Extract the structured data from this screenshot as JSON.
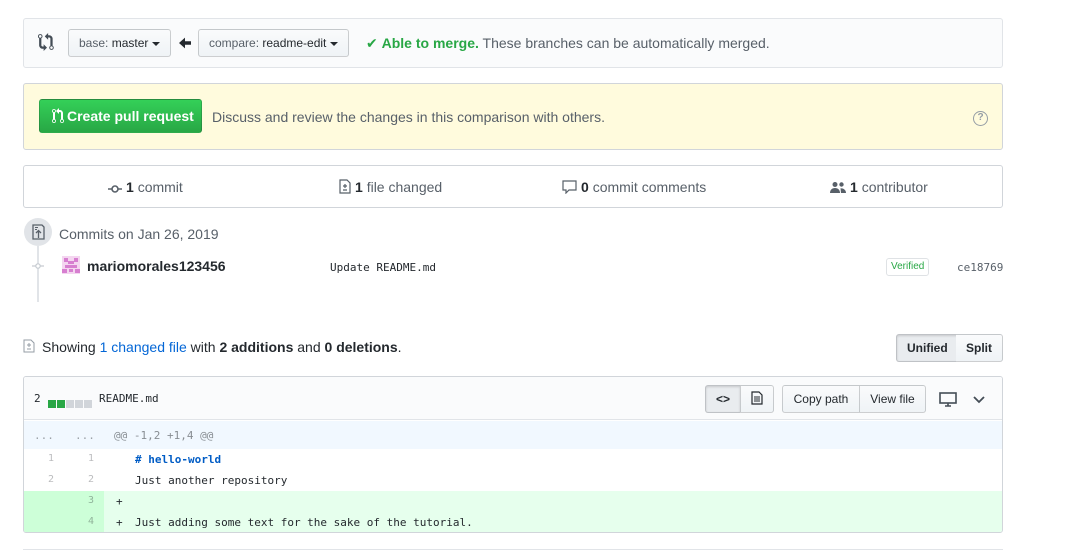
{
  "range": {
    "base_prefix": "base: ",
    "base_value": "master",
    "compare_prefix": "compare: ",
    "compare_value": "readme-edit",
    "merge_ok": "Able to merge.",
    "merge_text": "These branches can be automatically merged."
  },
  "pr_banner": {
    "button_label": "Create pull request",
    "text": "Discuss and review the changes in this comparison with others."
  },
  "summary": {
    "commits_num": "1",
    "commits_label": "commit",
    "files_num": "1",
    "files_label": "file changed",
    "comments_num": "0",
    "comments_label": "commit comments",
    "contributors_num": "1",
    "contributors_label": "contributor"
  },
  "commits": {
    "group_title": "Commits on Jan 26, 2019",
    "items": [
      {
        "author": "mariomorales123456",
        "message": "Update README.md",
        "badge": "Verified",
        "sha": "ce18769"
      }
    ]
  },
  "toc": {
    "showing": "Showing",
    "changed_link": "1 changed file",
    "with": "with",
    "additions": "2 additions",
    "and": "and",
    "deletions": "0 deletions",
    "period": "."
  },
  "view_toggle": {
    "unified": "Unified",
    "split": "Split",
    "selected": "Unified"
  },
  "file": {
    "diffstat_count": "2",
    "diffstat_blocks": [
      "add",
      "add",
      "neutral",
      "neutral",
      "neutral"
    ],
    "name": "README.md",
    "code_btn": "<>",
    "copy_path": "Copy path",
    "view_file": "View file",
    "hunk": {
      "left": "...",
      "right": "...",
      "header": "@@ -1,2 +1,4 @@"
    },
    "lines": [
      {
        "type": "context",
        "old": "1",
        "new": "1",
        "marker": " ",
        "text": "# hello-world"
      },
      {
        "type": "context",
        "old": "2",
        "new": "2",
        "marker": " ",
        "text": "Just another repository"
      },
      {
        "type": "add",
        "old": "",
        "new": "3",
        "marker": "+",
        "text": ""
      },
      {
        "type": "add",
        "old": "",
        "new": "4",
        "marker": "+",
        "text": "Just adding some text for the sake of the tutorial."
      }
    ]
  },
  "colors": {
    "green": "#28a745",
    "link": "#0366d6",
    "banner_bg": "#fffbdd",
    "add_bg": "#e6ffed",
    "add_gutter": "#cdffd8",
    "hunk_bg": "#f1f8ff",
    "hello_world_blue": "#005cc5"
  }
}
